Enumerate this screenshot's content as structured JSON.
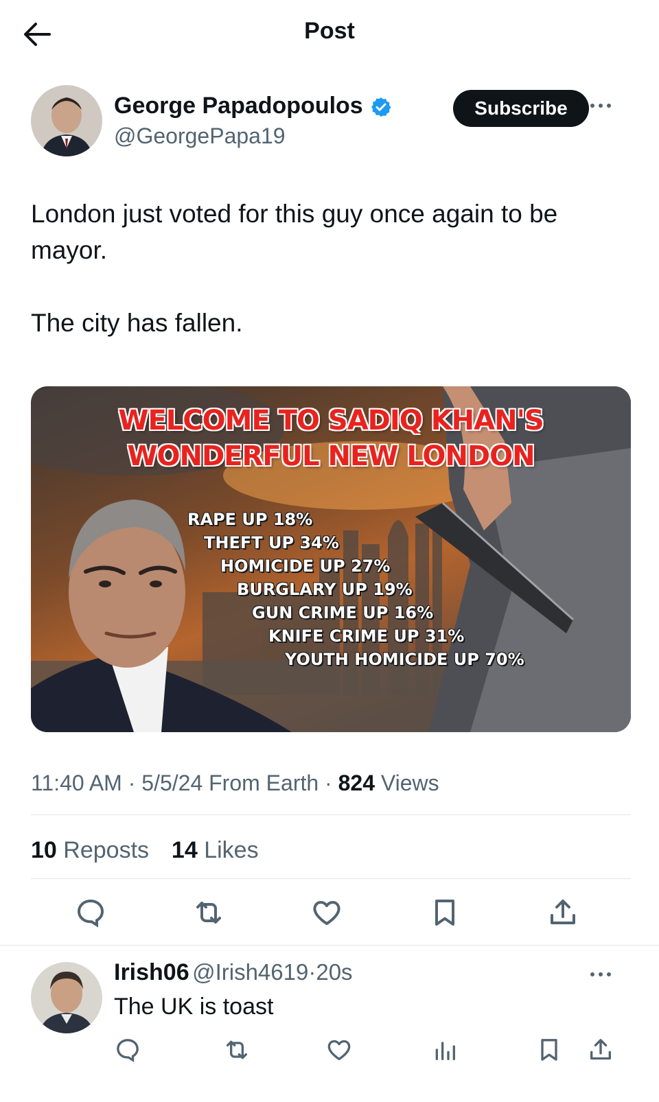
{
  "header": {
    "title": "Post"
  },
  "post": {
    "author_name": "George Papadopoulos",
    "author_handle": "@GeorgePapa19",
    "subscribe_label": "Subscribe",
    "text_line1": "London just voted for this guy once again to be mayor.",
    "text_line2": "The city has fallen.",
    "image": {
      "headline1": "WELCOME TO SADIQ KHAN'S",
      "headline2": "WONDERFUL NEW LONDON",
      "stats": [
        "RAPE UP 18%",
        "THEFT UP 34%",
        "HOMICIDE UP 27%",
        "BURGLARY UP 19%",
        "GUN CRIME UP 16%",
        "KNIFE CRIME UP 31%",
        "YOUTH HOMICIDE UP 70%"
      ]
    },
    "time": "11:40 AM",
    "date": "5/5/24",
    "source": "From Earth",
    "views_count": "824",
    "views_label": "Views",
    "reposts_count": "10",
    "reposts_label": "Reposts",
    "likes_count": "14",
    "likes_label": "Likes"
  },
  "reply": {
    "name": "Irish06",
    "handle": "@Irish4619",
    "time": "20s",
    "text": "The UK is toast"
  },
  "colors": {
    "verified": "#1d9bf0",
    "secondary_text": "#536471",
    "headline_red": "#e8231f"
  }
}
